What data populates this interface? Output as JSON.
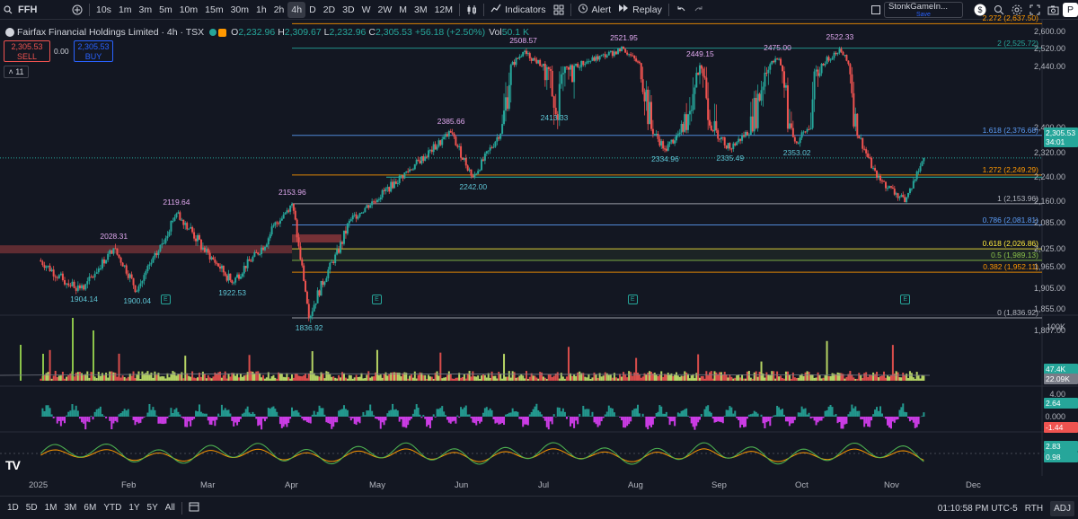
{
  "toolbar": {
    "symbol": "FFH",
    "timeframes": [
      "10s",
      "1m",
      "3m",
      "5m",
      "10m",
      "15m",
      "30m",
      "1h",
      "2h",
      "4h",
      "D",
      "2D",
      "3D",
      "W",
      "2W",
      "M",
      "3M",
      "12M"
    ],
    "active_timeframe": "4h",
    "indicators_label": "Indicators",
    "alert_label": "Alert",
    "replay_label": "Replay",
    "layout_name": "StonkGameIn...",
    "layout_status": "Save",
    "publish_label": "P"
  },
  "legend": {
    "name": "Fairfax Financial Holdings Limited · 4h · TSX",
    "o_label": "O",
    "o": "2,232.96",
    "h_label": "H",
    "h": "2,309.67",
    "l_label": "L",
    "l": "2,232.96",
    "c_label": "C",
    "c": "2,305.53",
    "change": "+56.18 (+2.50%)",
    "vol_label": "Vol",
    "vol": "50.1 K",
    "sell_price": "2,305.53",
    "sell_label": "SELL",
    "spread": "0.00",
    "buy_price": "2,305.53",
    "buy_label": "BUY",
    "collapse_count": "11"
  },
  "price_axis": [
    "2,600.00",
    "2,520.00",
    "2,440.00",
    "2,400.00",
    "2,320.00",
    "2,240.00",
    "2,160.00",
    "2,085.00",
    "2,025.00",
    "1,965.00",
    "1,905.00",
    "1,855.00",
    "1,807.00"
  ],
  "price_tag": {
    "price": "2,305.53",
    "countdown": "34:01"
  },
  "fib_levels": [
    {
      "label": "2.272 (2,637.50)",
      "color": "#ff9800"
    },
    {
      "label": "2 (2,525.72)",
      "color": "#26a69a"
    },
    {
      "label": "1.618 (2,376.68)",
      "color": "#5b9cf6"
    },
    {
      "label": "1.272 (2,249.29)",
      "color": "#ff9800"
    },
    {
      "label": "1 (2,153.96)",
      "color": "#b2b5be"
    },
    {
      "label": "0.786 (2,081.81)",
      "color": "#5b9cf6"
    },
    {
      "label": "0.618 (2,026.86)",
      "color": "#ffeb3b"
    },
    {
      "label": "0.5 (1,989.13)",
      "color": "#8bc34a"
    },
    {
      "label": "0.382 (1,952.11)",
      "color": "#ff9800"
    },
    {
      "label": "0 (1,836.92)",
      "color": "#b2b5be"
    }
  ],
  "annotations": {
    "highs": [
      "2119.64",
      "2028.31",
      "2153.96",
      "2385.66",
      "2508.57",
      "2521.95",
      "2449.15",
      "2475.00",
      "2522.33"
    ],
    "lows": [
      "1904.14",
      "1900.04",
      "1922.53",
      "1836.92",
      "2242.00",
      "2413.33",
      "2334.96",
      "2335.49",
      "2353.02"
    ]
  },
  "earnings_marker": "E",
  "volume_axis": {
    "top": "100K",
    "val1": "47.4K",
    "val2": "22.09K"
  },
  "osc1_axis": {
    "top": "4.00",
    "val1": "2.64",
    "mid": "0.000",
    "val2": "-1.44"
  },
  "osc2_axis": {
    "val1": "2.83",
    "val2": "0.98"
  },
  "x_axis": [
    "2025",
    "Feb",
    "Mar",
    "Apr",
    "May",
    "Jun",
    "Jul",
    "Aug",
    "Sep",
    "Oct",
    "Nov",
    "Dec"
  ],
  "logo": "TV",
  "bottom": {
    "ranges": [
      "1D",
      "5D",
      "1M",
      "3M",
      "6M",
      "YTD",
      "1Y",
      "5Y",
      "All"
    ],
    "time": "01:10:58 PM UTC-5",
    "session": "RTH",
    "adj": "ADJ"
  },
  "colors": {
    "up": "#26a69a",
    "down": "#ef5350",
    "bg": "#131722",
    "accent": "#2962ff"
  },
  "chart_data": {
    "type": "candlestick",
    "anchors": [
      {
        "x": "2025-01-02",
        "price": 1990
      },
      {
        "x": "2025-01-10",
        "price": 1930
      },
      {
        "x": "2025-01-17",
        "price": 1904.14
      },
      {
        "x": "2025-01-27",
        "price": 2028.31
      },
      {
        "x": "2025-02-04",
        "price": 1900.04
      },
      {
        "x": "2025-02-18",
        "price": 2119.64
      },
      {
        "x": "2025-03-10",
        "price": 1922.53
      },
      {
        "x": "2025-03-24",
        "price": 2060
      },
      {
        "x": "2025-04-01",
        "price": 2153.96
      },
      {
        "x": "2025-04-07",
        "price": 1836.92
      },
      {
        "x": "2025-04-22",
        "price": 2100
      },
      {
        "x": "2025-05-28",
        "price": 2385.66
      },
      {
        "x": "2025-06-05",
        "price": 2242.0
      },
      {
        "x": "2025-06-23",
        "price": 2508.57
      },
      {
        "x": "2025-07-04",
        "price": 2413.33
      },
      {
        "x": "2025-07-28",
        "price": 2521.95
      },
      {
        "x": "2025-08-12",
        "price": 2334.96
      },
      {
        "x": "2025-08-25",
        "price": 2449.15
      },
      {
        "x": "2025-09-05",
        "price": 2335.49
      },
      {
        "x": "2025-09-22",
        "price": 2475.0
      },
      {
        "x": "2025-09-29",
        "price": 2353.02
      },
      {
        "x": "2025-10-14",
        "price": 2522.33
      },
      {
        "x": "2025-10-27",
        "price": 2240
      },
      {
        "x": "2025-11-06",
        "price": 2160
      },
      {
        "x": "2025-11-13",
        "price": 2305.53
      }
    ],
    "y_range": [
      1807,
      2637.5
    ],
    "price_scale_ticks": [
      2600,
      2520,
      2440,
      2400,
      2320,
      2240,
      2160,
      2085,
      2025,
      1965,
      1905,
      1855,
      1807
    ],
    "x_range": [
      "2025-01-01",
      "2025-12-15"
    ],
    "last_close": 2305.53,
    "grid": false,
    "legend_position": "top-left"
  }
}
